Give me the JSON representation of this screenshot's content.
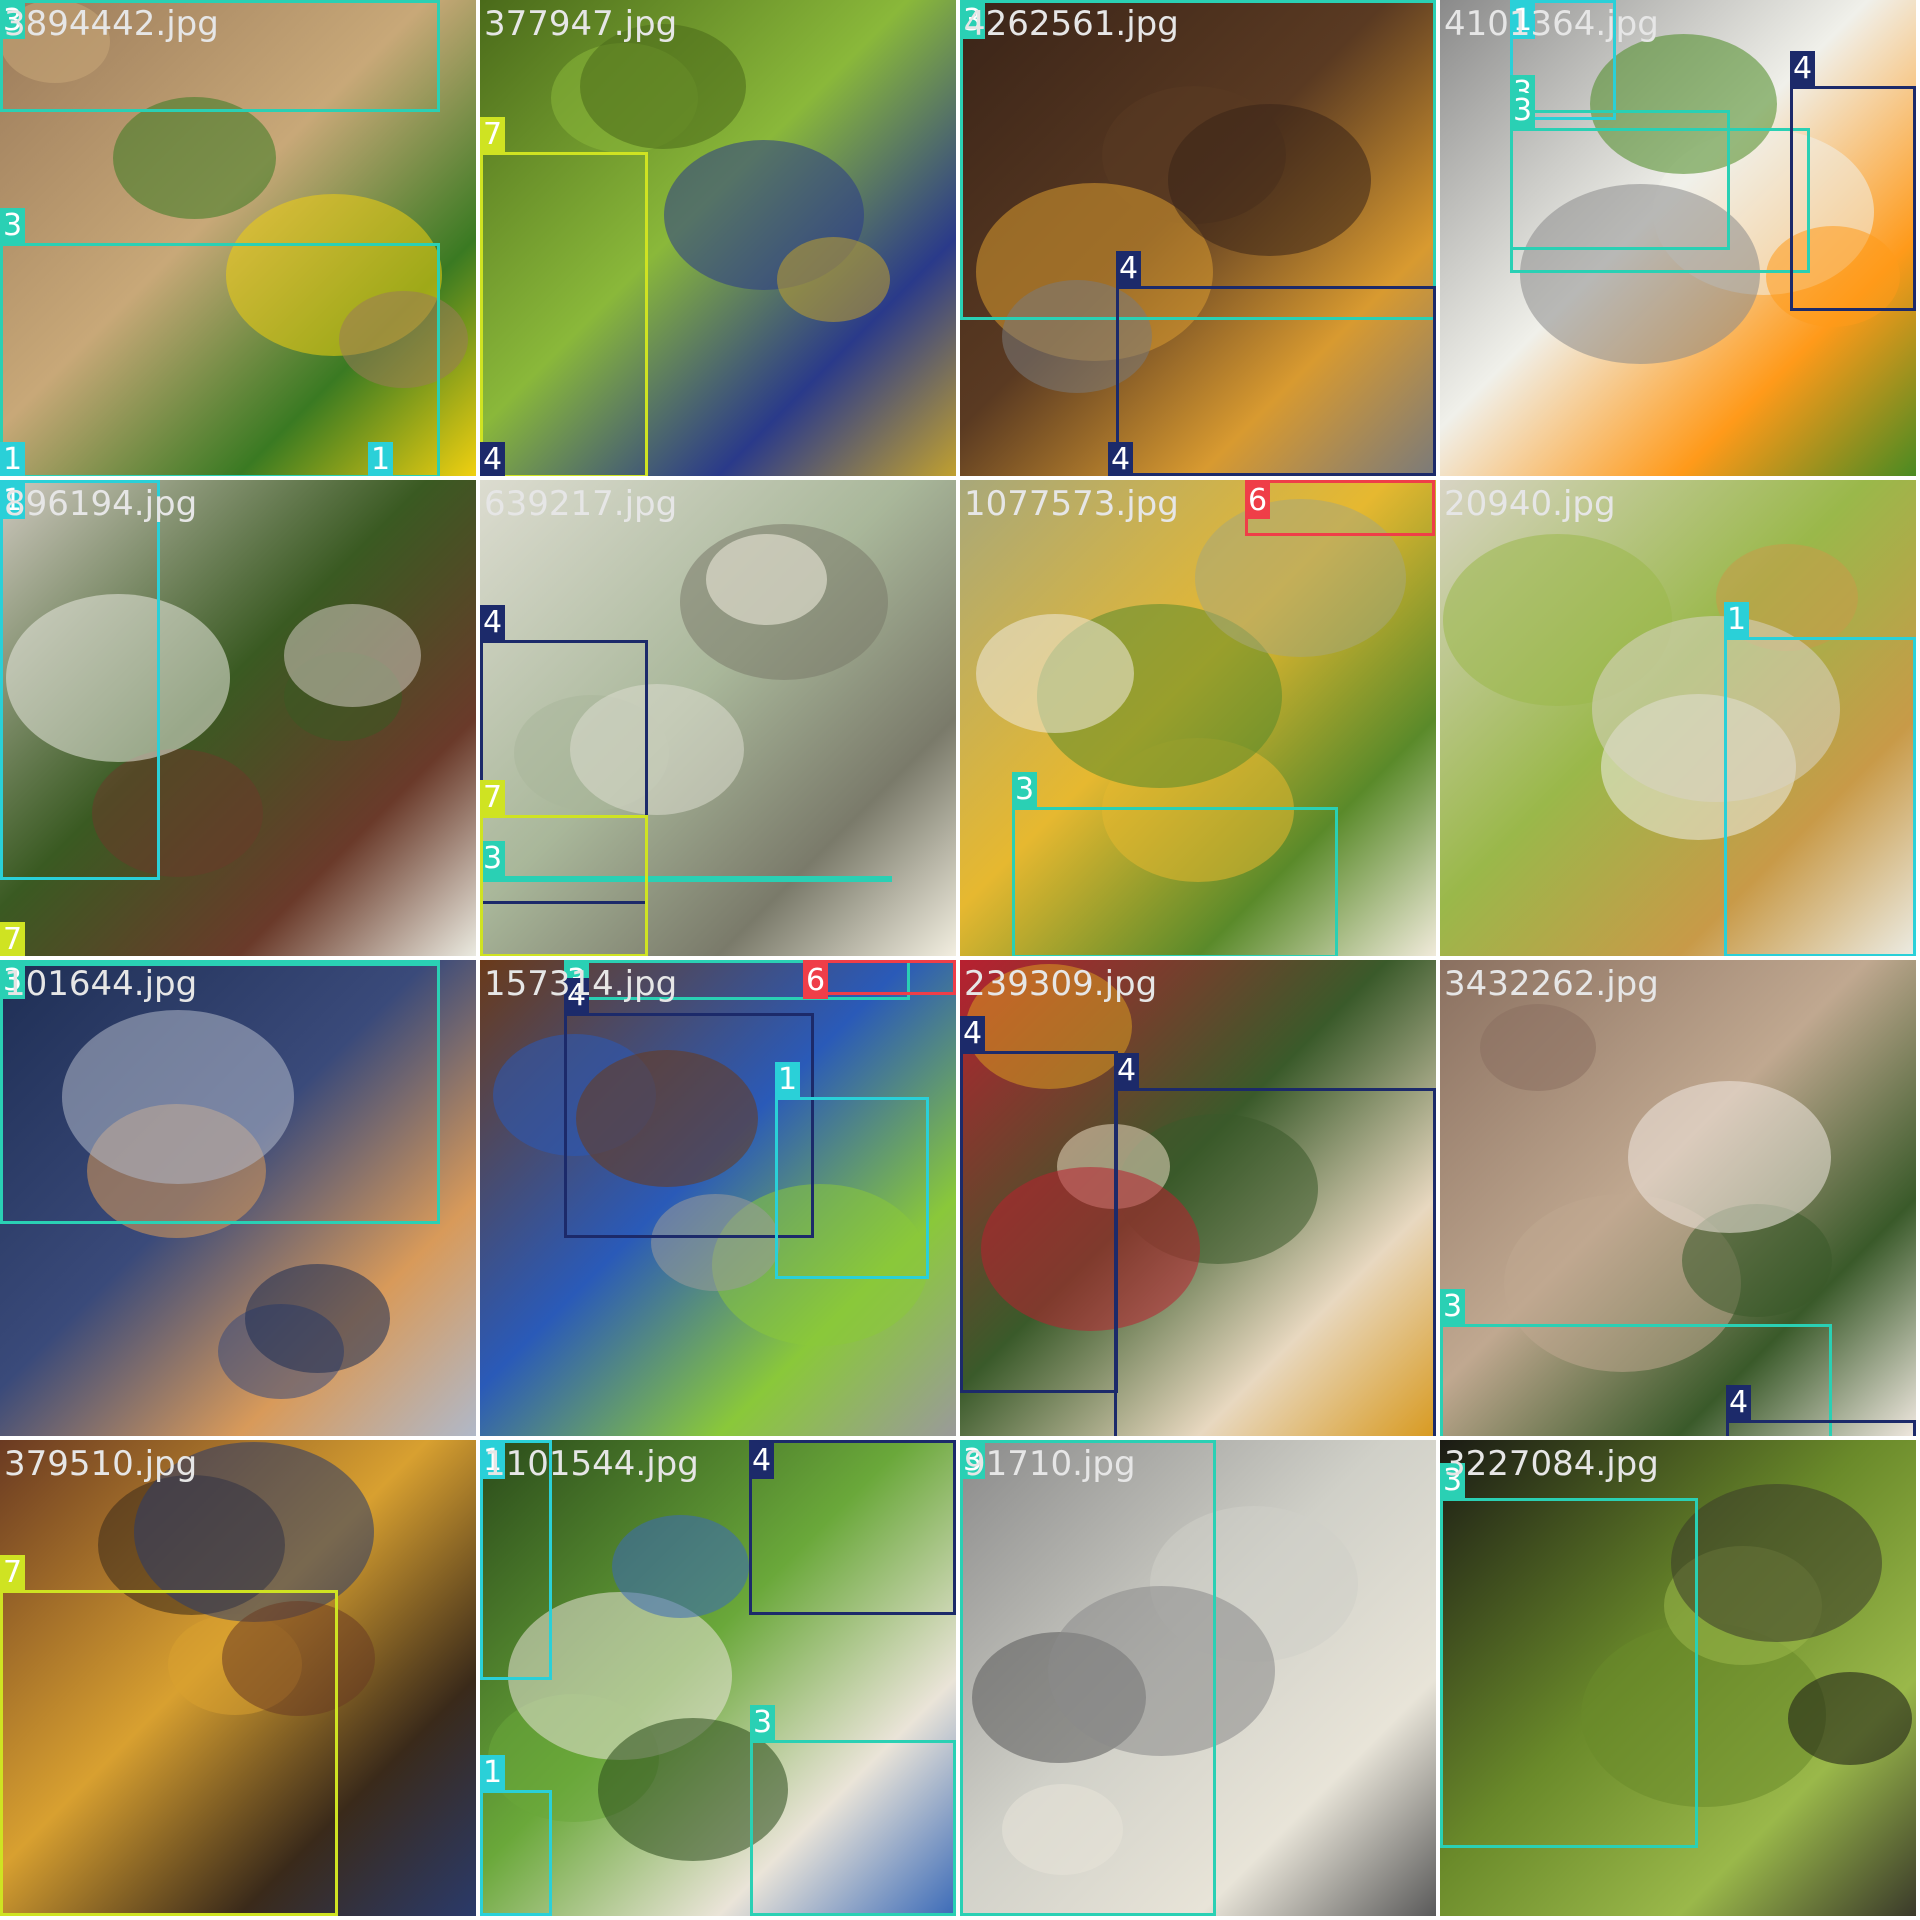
{
  "grid": {
    "columns": 4,
    "rows": 4
  },
  "classes": {
    "1": {
      "label": "1",
      "color": "#2ad0d8"
    },
    "3": {
      "label": "3",
      "color": "#2ad0b4"
    },
    "4": {
      "label": "4",
      "color": "#1c2a6a"
    },
    "6": {
      "label": "6",
      "color": "#ef3e48"
    },
    "7": {
      "label": "7",
      "color": "#cfe322"
    }
  },
  "tiles": [
    {
      "filename": "3894442.jpg",
      "palette": [
        "#9a7a5a",
        "#c8a878",
        "#3a7a22",
        "#f0d010"
      ]
    },
    {
      "filename": "377947.jpg",
      "palette": [
        "#4a6a1a",
        "#8ab83a",
        "#2a3a8a",
        "#c0a030"
      ]
    },
    {
      "filename": "4262561.jpg",
      "palette": [
        "#3a2418",
        "#5a3a22",
        "#d89a30",
        "#7a7a7a"
      ]
    },
    {
      "filename": "4101364.jpg",
      "palette": [
        "#8a8a8a",
        "#f0f0ea",
        "#ff9a1a",
        "#4a8a22"
      ]
    },
    {
      "filename": "896194.jpg",
      "palette": [
        "#cfc9c0",
        "#3a5a22",
        "#6a3a2a",
        "#eaeae0"
      ]
    },
    {
      "filename": "639217.jpg",
      "palette": [
        "#dcdcd0",
        "#a9b79a",
        "#7a7a6a",
        "#f2eee0"
      ]
    },
    {
      "filename": "1077573.jpg",
      "palette": [
        "#a8a87a",
        "#e6b830",
        "#5a8a2a",
        "#f0eada"
      ]
    },
    {
      "filename": "20940.jpg",
      "palette": [
        "#d8d4c4",
        "#9ab84a",
        "#c89a48",
        "#ecece4"
      ]
    },
    {
      "filename": "101644.jpg",
      "palette": [
        "#1e2e54",
        "#3a4a7a",
        "#d89a5a",
        "#b0b8c8"
      ]
    },
    {
      "filename": "157314.jpg",
      "palette": [
        "#6a3a1a",
        "#2a5ab8",
        "#8ac83a",
        "#9a9a9a"
      ]
    },
    {
      "filename": "239309.jpg",
      "palette": [
        "#b82030",
        "#3a5a2a",
        "#e8d8c0",
        "#d89a20"
      ]
    },
    {
      "filename": "3432262.jpg",
      "palette": [
        "#8a7060",
        "#c0a890",
        "#3a5a2a",
        "#f0e8e0"
      ]
    },
    {
      "filename": "379510.jpg",
      "palette": [
        "#6a3a22",
        "#d8a030",
        "#3a2a1a",
        "#2a3a6a"
      ]
    },
    {
      "filename": "1101544.jpg",
      "palette": [
        "#2a4a1a",
        "#6aa83a",
        "#eae4d8",
        "#3a6ab8"
      ]
    },
    {
      "filename": "91710.jpg",
      "palette": [
        "#8a8a8a",
        "#d0d0c8",
        "#e8e4d8",
        "#5a5a5a"
      ]
    },
    {
      "filename": "3227084.jpg",
      "palette": [
        "#1a1a14",
        "#6a8a2a",
        "#9ab84a",
        "#3a3a2a"
      ]
    }
  ],
  "annotations": [
    {
      "tile": 0,
      "cls": "3"
    },
    {
      "tile": 0,
      "cls": "3"
    },
    {
      "tile": 0,
      "cls": "1"
    },
    {
      "tile": 0,
      "cls": "1"
    },
    {
      "tile": 1,
      "cls": "7"
    },
    {
      "tile": 1,
      "cls": "4"
    },
    {
      "tile": 2,
      "cls": "3"
    },
    {
      "tile": 2,
      "cls": "4"
    },
    {
      "tile": 2,
      "cls": "4"
    },
    {
      "tile": 3,
      "cls": "1"
    },
    {
      "tile": 3,
      "cls": "3"
    },
    {
      "tile": 3,
      "cls": "3"
    },
    {
      "tile": 3,
      "cls": "4"
    },
    {
      "tile": 4,
      "cls": "1"
    },
    {
      "tile": 4,
      "cls": "7"
    },
    {
      "tile": 5,
      "cls": "3"
    },
    {
      "tile": 5,
      "cls": "4"
    },
    {
      "tile": 5,
      "cls": "7"
    },
    {
      "tile": 6,
      "cls": "3"
    },
    {
      "tile": 6,
      "cls": "6"
    },
    {
      "tile": 7,
      "cls": "1"
    },
    {
      "tile": 8,
      "cls": "3"
    },
    {
      "tile": 8,
      "cls": "3"
    },
    {
      "tile": 9,
      "cls": "3"
    },
    {
      "tile": 9,
      "cls": "6"
    },
    {
      "tile": 9,
      "cls": "4"
    },
    {
      "tile": 9,
      "cls": "1"
    },
    {
      "tile": 10,
      "cls": "4"
    },
    {
      "tile": 10,
      "cls": "4"
    },
    {
      "tile": 11,
      "cls": "3"
    },
    {
      "tile": 11,
      "cls": "4"
    },
    {
      "tile": 12,
      "cls": "7"
    },
    {
      "tile": 13,
      "cls": "1"
    },
    {
      "tile": 13,
      "cls": "4"
    },
    {
      "tile": 13,
      "cls": "3"
    },
    {
      "tile": 13,
      "cls": "1"
    },
    {
      "tile": 14,
      "cls": "3"
    },
    {
      "tile": 15,
      "cls": "3"
    }
  ]
}
